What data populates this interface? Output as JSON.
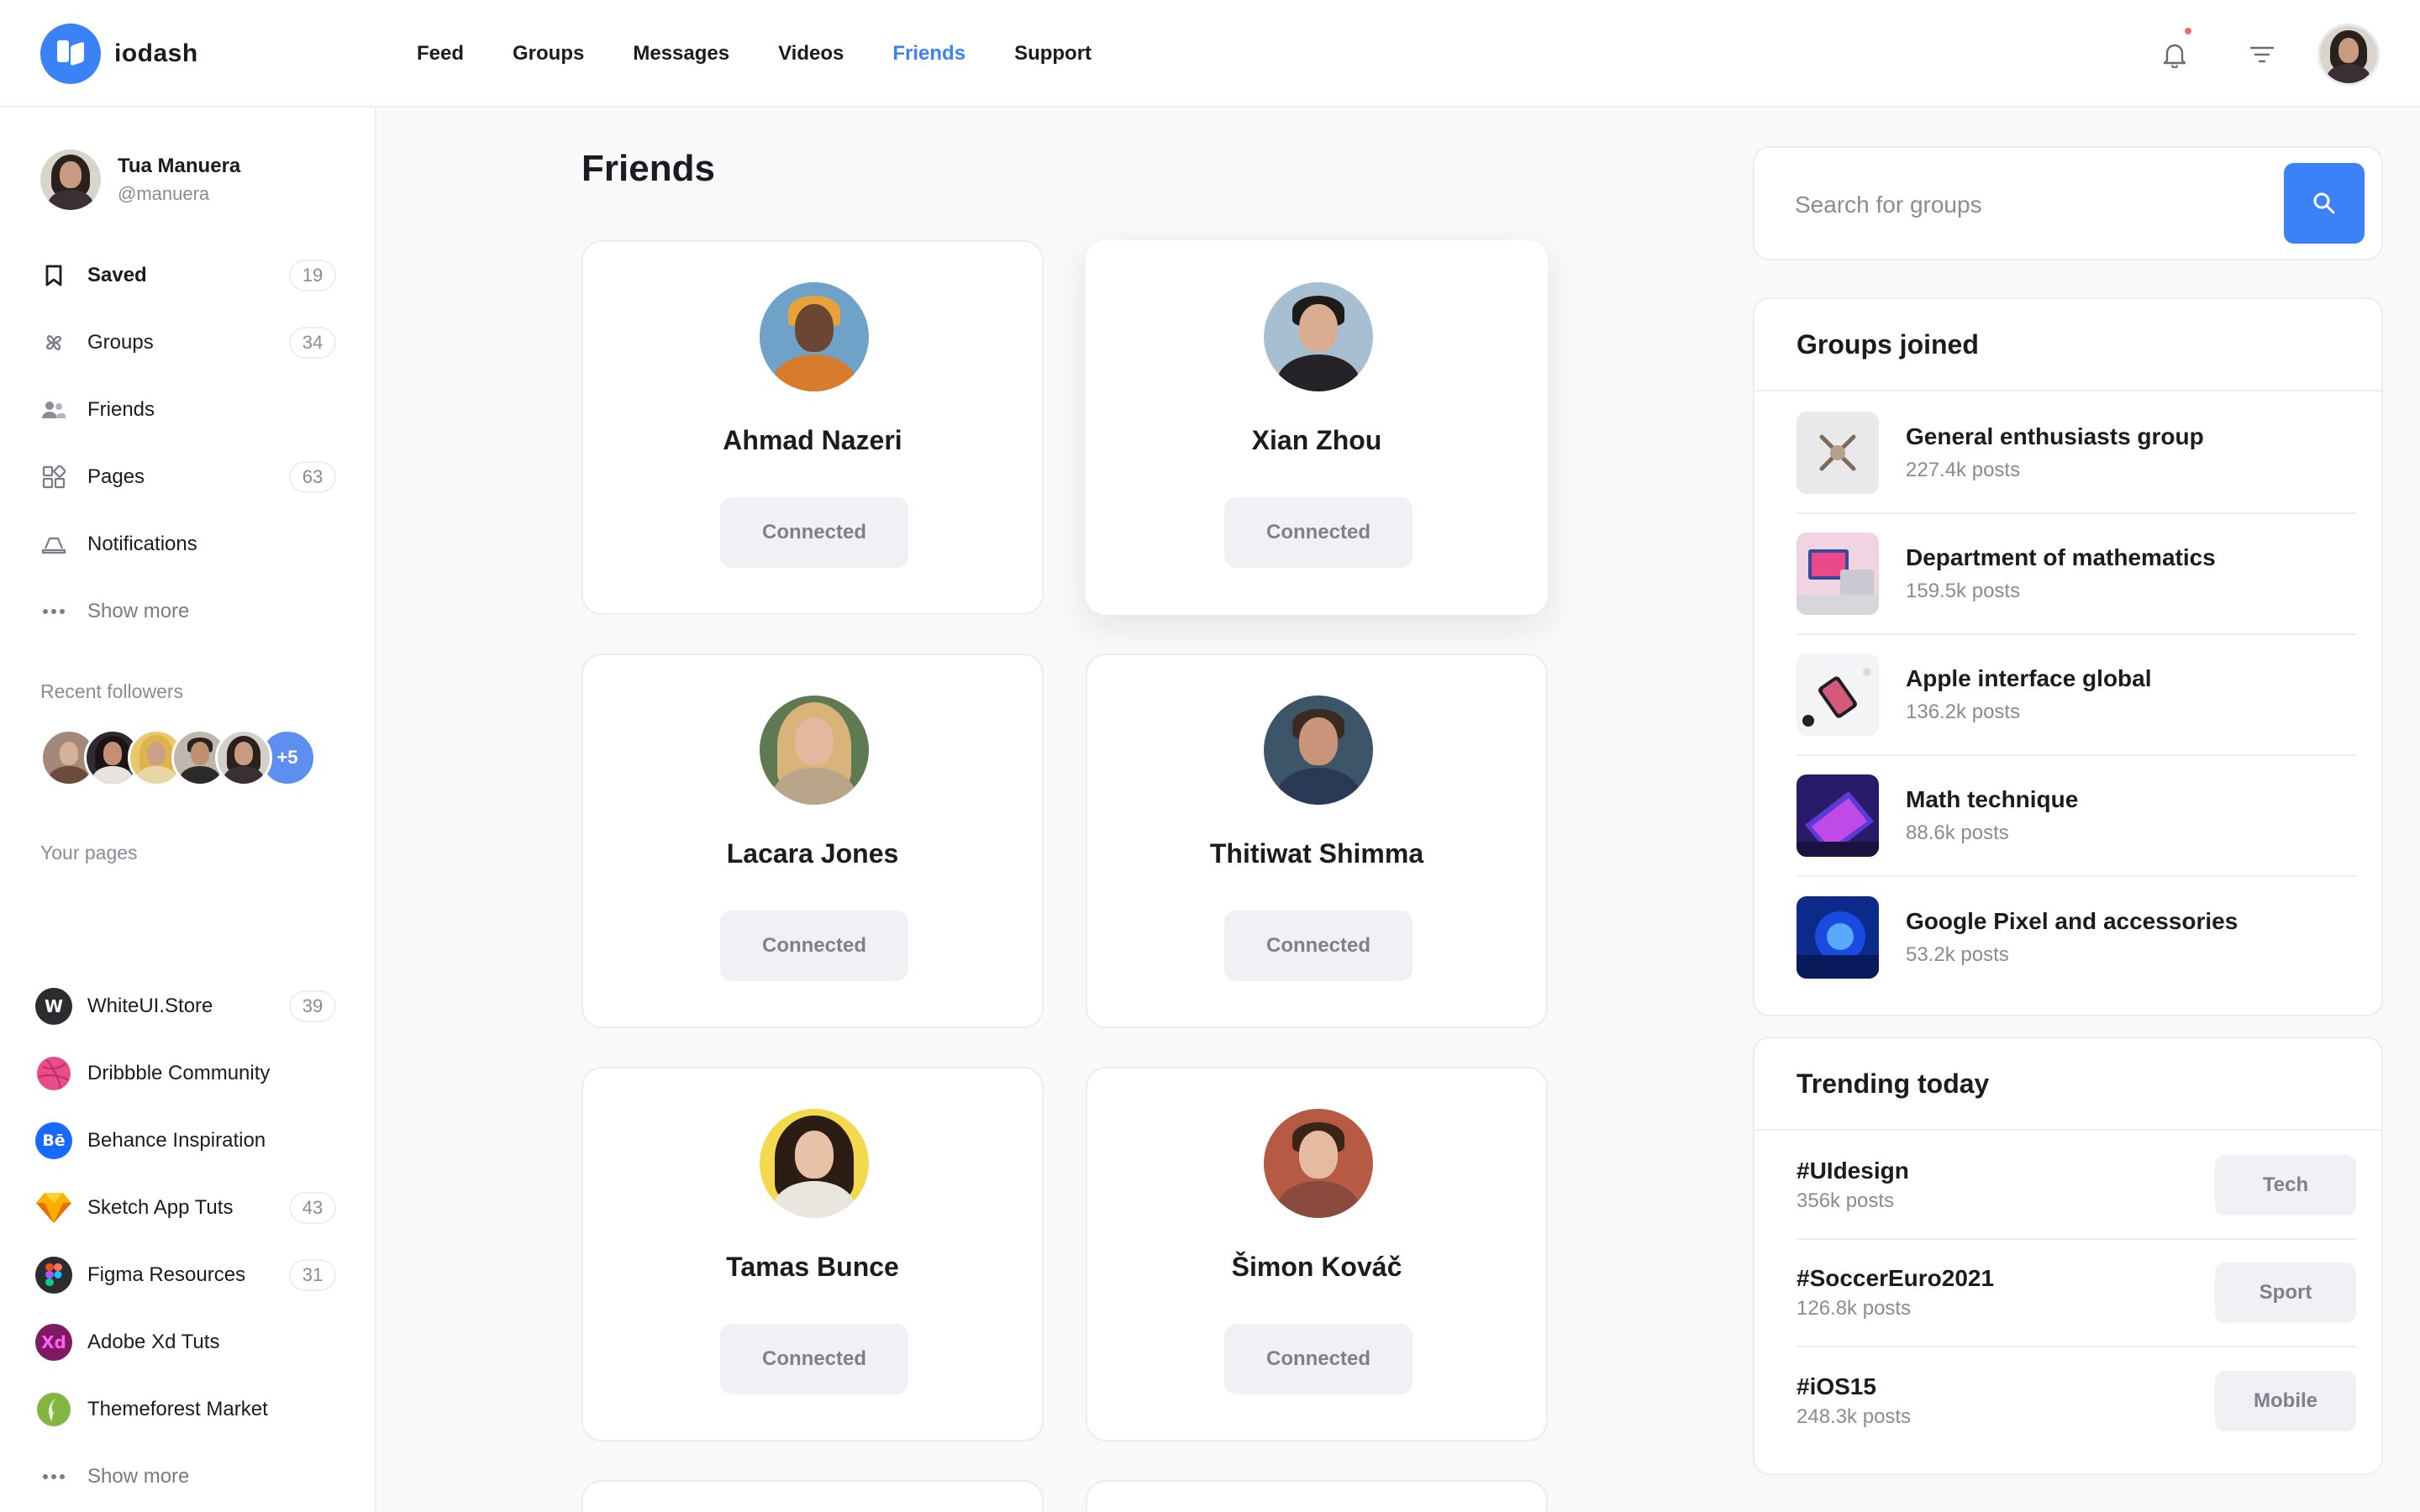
{
  "brand": {
    "name": "iodash",
    "accent": "#3b82f6"
  },
  "nav": [
    "Feed",
    "Groups",
    "Messages",
    "Videos",
    "Friends",
    "Support"
  ],
  "nav_active": "Friends",
  "header_icons": [
    "bell-icon",
    "filter-icon"
  ],
  "user": {
    "name": "Tua Manuera",
    "handle": "@manuera"
  },
  "sidebar": {
    "items": [
      {
        "label": "Saved",
        "count": "19",
        "icon": "bookmark-icon"
      },
      {
        "label": "Groups",
        "count": "34",
        "icon": "pinwheel-icon"
      },
      {
        "label": "Friends",
        "count": "",
        "icon": "friends-icon"
      },
      {
        "label": "Pages",
        "count": "63",
        "icon": "pages-grid-icon"
      },
      {
        "label": "Notifications",
        "count": "",
        "icon": "bell-tray-icon"
      },
      {
        "label": "Show more",
        "count": "",
        "icon": "more-dots-icon"
      }
    ],
    "followers_label": "Recent followers",
    "followers_more": "+5",
    "pages_label": "Your pages",
    "pages": [
      {
        "label": "WhiteUI.Store",
        "count": "39",
        "logo": "W"
      },
      {
        "label": "Dribbble Community",
        "count": "",
        "logo": ""
      },
      {
        "label": "Behance Inspiration",
        "count": "",
        "logo": "Bē"
      },
      {
        "label": "Sketch App Tuts",
        "count": "43",
        "logo": ""
      },
      {
        "label": "Figma Resources",
        "count": "31",
        "logo": ""
      },
      {
        "label": "Adobe Xd Tuts",
        "count": "",
        "logo": "Xd"
      },
      {
        "label": "Themeforest Market",
        "count": "",
        "logo": ""
      }
    ],
    "pages_more": "Show more"
  },
  "main": {
    "title": "Friends",
    "friends": [
      {
        "name": "Ahmad Nazeri",
        "status": "Connected"
      },
      {
        "name": "Xian Zhou",
        "status": "Connected"
      },
      {
        "name": "Lacara Jones",
        "status": "Connected"
      },
      {
        "name": "Thitiwat Shimma",
        "status": "Connected"
      },
      {
        "name": "Tamas Bunce",
        "status": "Connected"
      },
      {
        "name": "Šimon Kováč",
        "status": "Connected"
      }
    ]
  },
  "search": {
    "placeholder": "Search for groups"
  },
  "groups": {
    "title": "Groups joined",
    "items": [
      {
        "name": "General enthusiasts group",
        "posts": "227.4k posts"
      },
      {
        "name": "Department of mathematics",
        "posts": "159.5k posts"
      },
      {
        "name": "Apple interface global",
        "posts": "136.2k posts"
      },
      {
        "name": "Math technique",
        "posts": "88.6k posts"
      },
      {
        "name": "Google Pixel and accessories",
        "posts": "53.2k posts"
      }
    ]
  },
  "trending": {
    "title": "Trending today",
    "items": [
      {
        "tag": "#UIdesign",
        "posts": "356k posts",
        "category": "Tech"
      },
      {
        "tag": "#SoccerEuro2021",
        "posts": "126.8k posts",
        "category": "Sport"
      },
      {
        "tag": "#iOS15",
        "posts": "248.3k posts",
        "category": "Mobile"
      }
    ]
  }
}
